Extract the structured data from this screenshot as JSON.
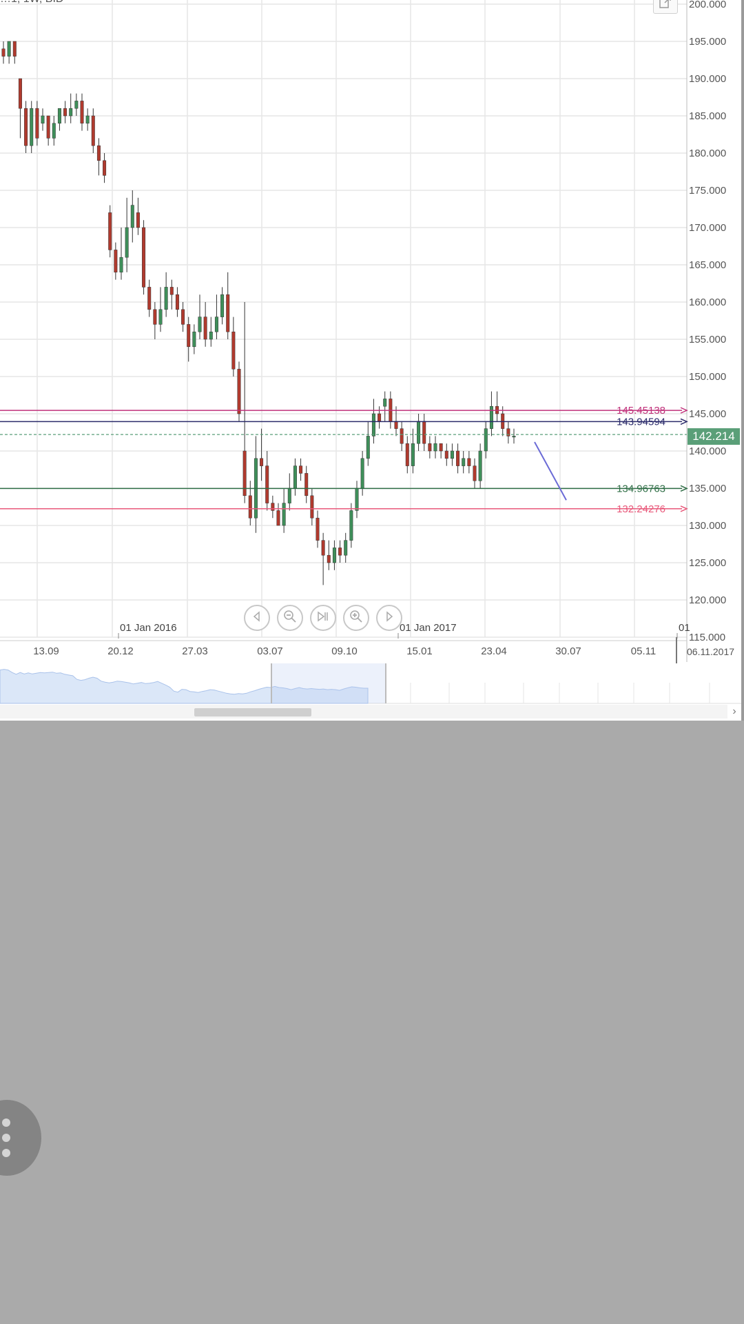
{
  "header": {
    "label": "…1, 1W, BID"
  },
  "chart_data": {
    "type": "candlestick",
    "y_axis": {
      "range": [
        115,
        200
      ],
      "tick_labels": [
        "200.000",
        "195.000",
        "190.000",
        "185.000",
        "180.000",
        "175.000",
        "170.000",
        "165.000",
        "160.000",
        "155.000",
        "150.000",
        "145.000",
        "140.000",
        "135.000",
        "130.000",
        "125.000",
        "120.000",
        "115.000"
      ]
    },
    "x_axis": {
      "tick_labels": [
        "13.09",
        "20.12",
        "27.03",
        "03.07",
        "09.10",
        "15.01",
        "23.04",
        "30.07",
        "05.11"
      ],
      "year_labels": [
        "01 Jan 2016",
        "01 Jan 2017",
        "01"
      ],
      "current_date": "06.11.2017"
    },
    "current_price": {
      "value": 142.214,
      "label": "142.214"
    },
    "levels": [
      {
        "label": "145.45138",
        "value": 145.45138,
        "color": "#c0307a"
      },
      {
        "label": "143.94594",
        "value": 143.94594,
        "color": "#2a2a6a"
      },
      {
        "label": "134.96763",
        "value": 134.96763,
        "color": "#2f6e46"
      },
      {
        "label": "132.24276",
        "value": 132.24276,
        "color": "#e8587a"
      }
    ],
    "candles": [
      [
        194,
        193,
        195,
        192
      ],
      [
        193,
        195,
        195,
        192
      ],
      [
        195,
        193,
        195,
        192
      ],
      [
        190,
        186,
        190,
        182
      ],
      [
        186,
        181,
        187,
        180
      ],
      [
        181,
        186,
        187,
        180
      ],
      [
        186,
        182,
        187,
        181
      ],
      [
        184,
        185,
        186,
        183
      ],
      [
        185,
        182,
        185,
        181
      ],
      [
        182,
        184,
        185,
        181
      ],
      [
        184,
        186,
        186,
        183
      ],
      [
        186,
        185,
        187,
        184
      ],
      [
        185,
        186,
        188,
        184
      ],
      [
        186,
        187,
        188,
        185
      ],
      [
        187,
        184,
        188,
        183
      ],
      [
        184,
        185,
        186,
        183
      ],
      [
        185,
        181,
        186,
        180
      ],
      [
        181,
        179,
        182,
        177
      ],
      [
        179,
        177,
        180,
        176
      ],
      [
        172,
        167,
        173,
        166
      ],
      [
        167,
        164,
        168,
        163
      ],
      [
        164,
        166,
        170,
        163
      ],
      [
        166,
        170,
        174,
        164
      ],
      [
        170,
        173,
        175,
        168
      ],
      [
        172,
        170,
        174,
        169
      ],
      [
        170,
        162,
        171,
        161
      ],
      [
        162,
        159,
        163,
        158
      ],
      [
        159,
        157,
        160,
        155
      ],
      [
        157,
        159,
        162,
        156
      ],
      [
        159,
        162,
        164,
        158
      ],
      [
        162,
        161,
        163,
        159
      ],
      [
        161,
        159,
        162,
        158
      ],
      [
        159,
        157,
        160,
        156
      ],
      [
        157,
        154,
        158,
        152
      ],
      [
        154,
        156,
        157,
        153
      ],
      [
        156,
        158,
        161,
        155
      ],
      [
        158,
        155,
        160,
        154
      ],
      [
        155,
        156,
        158,
        154
      ],
      [
        156,
        158,
        161,
        155
      ],
      [
        158,
        161,
        162,
        157
      ],
      [
        161,
        156,
        164,
        155
      ],
      [
        156,
        151,
        158,
        150
      ],
      [
        151,
        145,
        152,
        144
      ],
      [
        140,
        134,
        160,
        133
      ],
      [
        134,
        131,
        136,
        130
      ],
      [
        131,
        139,
        142,
        129
      ],
      [
        139,
        138,
        143,
        136
      ],
      [
        138,
        133,
        140,
        132
      ],
      [
        133,
        132,
        134,
        131
      ],
      [
        132,
        130,
        133,
        130
      ],
      [
        130,
        133,
        135,
        129
      ],
      [
        133,
        135,
        137,
        132
      ],
      [
        135,
        138,
        139,
        134
      ],
      [
        138,
        137,
        139,
        136
      ],
      [
        137,
        134,
        138,
        133
      ],
      [
        134,
        131,
        135,
        130
      ],
      [
        131,
        128,
        132,
        127
      ],
      [
        128,
        126,
        129,
        122
      ],
      [
        126,
        125,
        128,
        124
      ],
      [
        125,
        127,
        128,
        124
      ],
      [
        127,
        126,
        128,
        125
      ],
      [
        126,
        128,
        129,
        125
      ],
      [
        128,
        132,
        133,
        127
      ],
      [
        132,
        135,
        136,
        131
      ],
      [
        135,
        139,
        140,
        134
      ],
      [
        139,
        142,
        144,
        138
      ],
      [
        142,
        145,
        147,
        141
      ],
      [
        145,
        144,
        146,
        143
      ],
      [
        146,
        147,
        148,
        144
      ],
      [
        147,
        144,
        148,
        143
      ],
      [
        144,
        143,
        146,
        142
      ],
      [
        143,
        141,
        144,
        140
      ],
      [
        141,
        138,
        142,
        137
      ],
      [
        138,
        141,
        143,
        137
      ],
      [
        141,
        144,
        145,
        140
      ],
      [
        144,
        141,
        145,
        140
      ],
      [
        141,
        140,
        142,
        139
      ],
      [
        140,
        141,
        142,
        139
      ],
      [
        141,
        140,
        141,
        139
      ],
      [
        140,
        139,
        141,
        138
      ],
      [
        139,
        140,
        141,
        138
      ],
      [
        140,
        138,
        141,
        137
      ],
      [
        138,
        139,
        140,
        137
      ],
      [
        139,
        138,
        140,
        137
      ],
      [
        138,
        136,
        139,
        135
      ],
      [
        136,
        140,
        141,
        135
      ],
      [
        140,
        143,
        144,
        139
      ],
      [
        143,
        146,
        148,
        142
      ],
      [
        146,
        145,
        148,
        144
      ],
      [
        145,
        143,
        146,
        142
      ],
      [
        143,
        142,
        144,
        141
      ],
      [
        142,
        142,
        143,
        141
      ]
    ]
  },
  "navigator": {
    "buttons": [
      {
        "name": "scroll-left-button",
        "icon": "triangle-left-icon"
      },
      {
        "name": "zoom-out-button",
        "icon": "magnifier-minus-icon"
      },
      {
        "name": "reset-button",
        "icon": "skip-to-end-icon"
      },
      {
        "name": "zoom-in-button",
        "icon": "magnifier-plus-icon"
      },
      {
        "name": "scroll-right-button",
        "icon": "triangle-right-icon"
      }
    ]
  },
  "colors": {
    "bull": "#3f8f5a",
    "bear": "#b03a2e",
    "wick": "#444444",
    "grid": "#e6e6e6",
    "trendline": "#6b6bd6",
    "background": "#ffffff",
    "outer": "#aaaaaa"
  }
}
